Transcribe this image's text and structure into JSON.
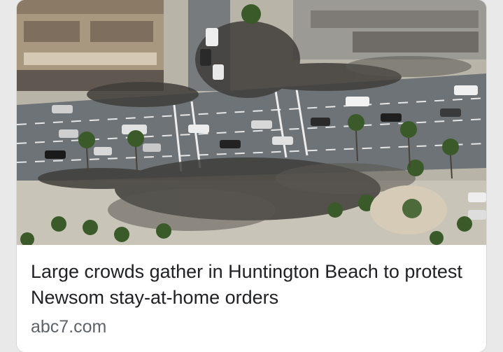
{
  "article": {
    "headline": "Large crowds gather in Huntington Beach to protest Newsom stay-at-home orders",
    "source": "abc7.com"
  },
  "colors": {
    "card_background": "#ffffff",
    "page_background": "#e9e9e9",
    "headline_text": "#202124",
    "source_text": "#5f6368",
    "road": "#6e7377",
    "sidewalk": "#c9c4b8"
  },
  "image": {
    "subject": "aerial-crowd-protest-photo"
  }
}
